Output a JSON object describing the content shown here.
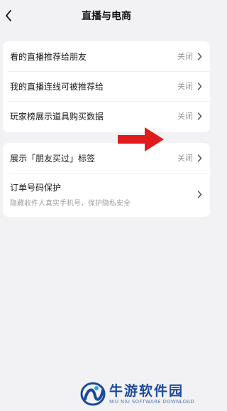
{
  "header": {
    "title": "直播与电商",
    "back_icon": "chevron-left-icon"
  },
  "card1": {
    "items": [
      {
        "label": "看的直播推荐给朋友",
        "value": "关闭"
      },
      {
        "label": "我的直播连线可被推荐给",
        "value": "关闭"
      },
      {
        "label": "玩家榜展示道具购买数据",
        "value": "关闭"
      }
    ]
  },
  "card2": {
    "items": [
      {
        "label": "展示「朋友买过」标签",
        "value": "关闭"
      },
      {
        "label": "订单号码保护",
        "sub": "隐藏收件人真实手机号，保护隐私安全"
      }
    ]
  },
  "annotation": {
    "arrow_color": "#e01b1b",
    "icon": "red-arrow-right-icon"
  },
  "watermark": {
    "title": "牛游软件园",
    "subtitle": "NIU NIU SOFTWARE DOWNLOAD",
    "color": "#1a4a9a"
  }
}
